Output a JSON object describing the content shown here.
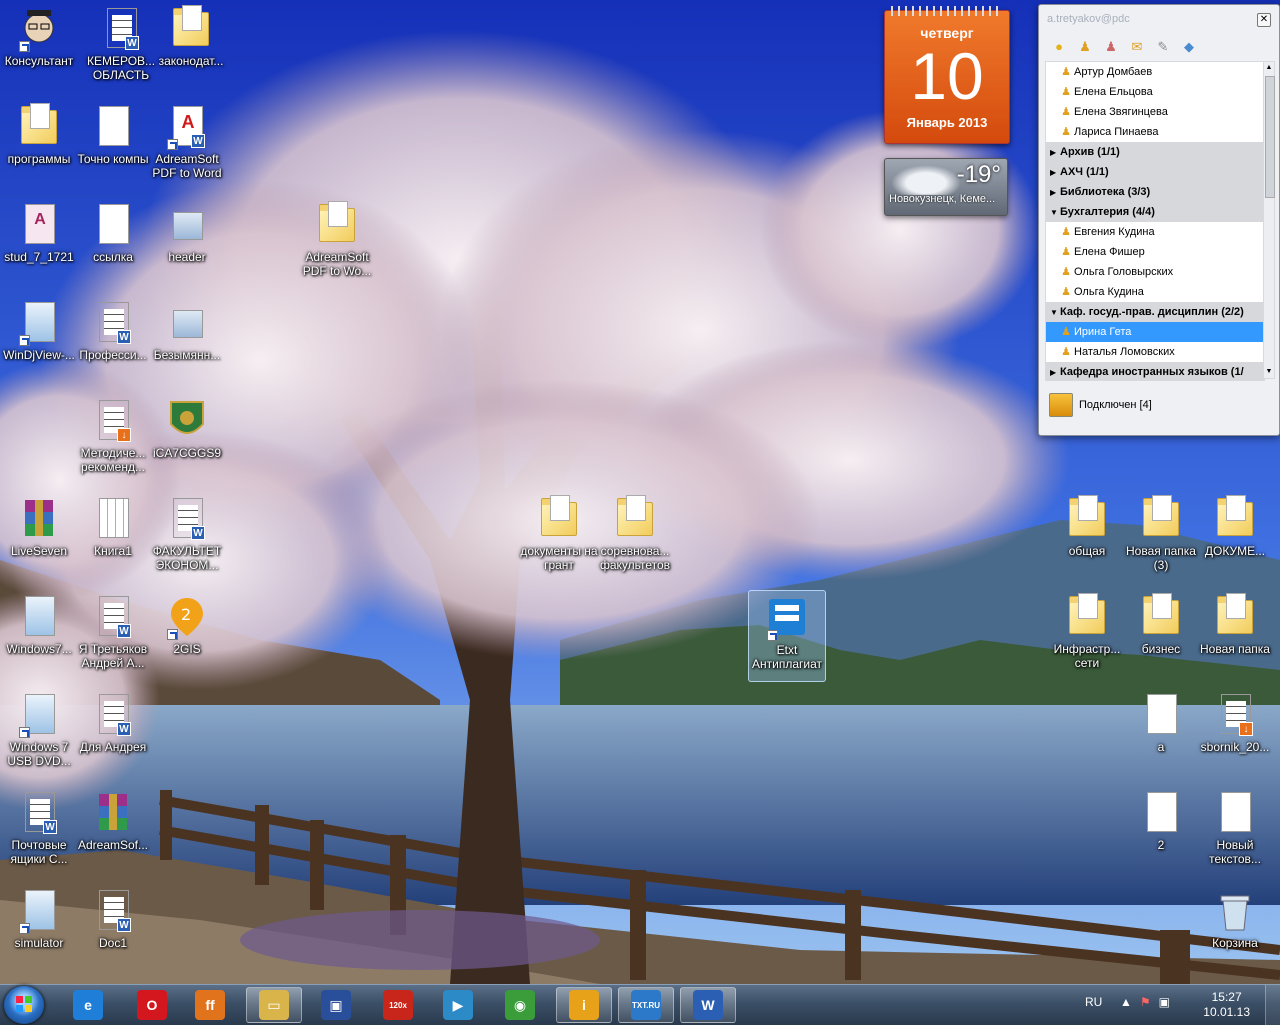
{
  "desktop_icons": [
    {
      "label": "Консультант",
      "icon": "consultant-icon",
      "type": "shortcut"
    },
    {
      "label": "КЕМЕРОВ... ОБЛАСТЬ",
      "icon": "word-doc-icon",
      "type": "doc"
    },
    {
      "label": "законодат...",
      "icon": "folder-icon",
      "type": "folder"
    },
    {
      "label": "программы",
      "icon": "folder-icon",
      "type": "folder"
    },
    {
      "label": "Точно компы",
      "icon": "text-file-icon",
      "type": "doc"
    },
    {
      "label": "AdreamSoft PDF to Word",
      "icon": "pdf-to-word-icon",
      "type": "shortcut"
    },
    {
      "label": "stud_7_1721",
      "icon": "access-db-icon",
      "type": "doc"
    },
    {
      "label": "ссылка",
      "icon": "text-file-icon",
      "type": "doc"
    },
    {
      "label": "header",
      "icon": "image-file-icon",
      "type": "doc"
    },
    {
      "label": "AdreamSoft PDF to Wo...",
      "icon": "folder-icon",
      "type": "folder"
    },
    {
      "label": "WinDjView-...",
      "icon": "installer-icon",
      "type": "shortcut"
    },
    {
      "label": "Професси...",
      "icon": "word-doc-icon",
      "type": "doc"
    },
    {
      "label": "Безымянн...",
      "icon": "image-file-icon",
      "type": "doc"
    },
    {
      "label": "Методиче... рекоменд...",
      "icon": "djvu-doc-icon",
      "type": "doc"
    },
    {
      "label": "iCA7CGGS9",
      "icon": "coat-of-arms-icon",
      "type": "doc"
    },
    {
      "label": "LiveSeven",
      "icon": "winrar-icon",
      "type": "doc"
    },
    {
      "label": "Книга1",
      "icon": "excel-doc-icon",
      "type": "doc"
    },
    {
      "label": "ФАКУЛЬТЕТ ЭКОНОМ...",
      "icon": "word-doc-icon",
      "type": "doc"
    },
    {
      "label": "Windows7...",
      "icon": "installer-icon",
      "type": "doc"
    },
    {
      "label": "Я Третьяков Андрей А...",
      "icon": "word-doc-icon",
      "type": "doc"
    },
    {
      "label": "2GIS",
      "icon": "2gis-icon",
      "type": "shortcut"
    },
    {
      "label": "Windows 7 USB DVD...",
      "icon": "windows-usb-icon",
      "type": "shortcut"
    },
    {
      "label": "Для Андрея",
      "icon": "word-doc-icon",
      "type": "doc"
    },
    {
      "label": "Почтовые ящики С...",
      "icon": "word-doc-icon",
      "type": "doc"
    },
    {
      "label": "AdreamSof...",
      "icon": "winrar-icon",
      "type": "doc"
    },
    {
      "label": "simulator",
      "icon": "simulator-icon",
      "type": "shortcut"
    },
    {
      "label": "Doc1",
      "icon": "word-doc-icon",
      "type": "doc"
    },
    {
      "label": "документы на грант",
      "icon": "folder-icon",
      "type": "folder"
    },
    {
      "label": "соревнова... факультетов",
      "icon": "folder-icon",
      "type": "folder"
    },
    {
      "label": "Etxt Антиплагиат",
      "icon": "etxt-icon",
      "type": "shortcut"
    },
    {
      "label": "общая",
      "icon": "folder-icon",
      "type": "folder"
    },
    {
      "label": "Новая папка (3)",
      "icon": "folder-icon",
      "type": "folder"
    },
    {
      "label": "ДОКУМЕ...",
      "icon": "folder-icon",
      "type": "folder"
    },
    {
      "label": "Инфрастр... сети",
      "icon": "folder-icon",
      "type": "folder"
    },
    {
      "label": "бизнес",
      "icon": "folder-icon",
      "type": "folder"
    },
    {
      "label": "Новая папка",
      "icon": "folder-icon",
      "type": "folder"
    },
    {
      "label": "a",
      "icon": "text-file-icon",
      "type": "doc"
    },
    {
      "label": "sbornik_20...",
      "icon": "djvu-doc-icon",
      "type": "doc"
    },
    {
      "label": "2",
      "icon": "text-file-icon",
      "type": "doc"
    },
    {
      "label": "Новый текстов...",
      "icon": "text-file-icon",
      "type": "doc"
    },
    {
      "label": "Корзина",
      "icon": "recycle-bin-icon",
      "type": "doc"
    }
  ],
  "calendar": {
    "weekday": "четверг",
    "day": "10",
    "month_year": "Январь 2013"
  },
  "weather": {
    "temp": "-19°",
    "city": "Новокузнецк, Кеме..."
  },
  "im": {
    "account": "a.tretyakov@pdc",
    "toolbar_icons": [
      "lamp-icon",
      "user-icon",
      "users-icon",
      "mail-icon",
      "pin-icon",
      "tag-icon"
    ],
    "rows": [
      {
        "kind": "contact",
        "label": "Артур Домбаев"
      },
      {
        "kind": "contact",
        "label": "Елена Ельцова"
      },
      {
        "kind": "contact",
        "label": "Елена Звягинцева"
      },
      {
        "kind": "contact",
        "label": "Лариса Пинаева"
      },
      {
        "kind": "group",
        "label": "Архив (1/1)",
        "expanded": false
      },
      {
        "kind": "group",
        "label": "АХЧ (1/1)",
        "expanded": false
      },
      {
        "kind": "group",
        "label": "Библиотека (3/3)",
        "expanded": false
      },
      {
        "kind": "group",
        "label": "Бухгалтерия (4/4)",
        "expanded": true
      },
      {
        "kind": "contact",
        "label": "Евгения Кудина"
      },
      {
        "kind": "contact",
        "label": "Елена Фишер"
      },
      {
        "kind": "contact",
        "label": "Ольга Головырских"
      },
      {
        "kind": "contact",
        "label": "Ольга Кудина"
      },
      {
        "kind": "group",
        "label": "Каф. госуд.-прав. дисциплин (2/2)",
        "expanded": true
      },
      {
        "kind": "contact",
        "label": "Ирина Гета",
        "selected": true
      },
      {
        "kind": "contact",
        "label": "Наталья Ломовских"
      },
      {
        "kind": "group",
        "label": "Кафедра иностранных языков (1/",
        "expanded": false
      }
    ],
    "status": "Подключен [4]"
  },
  "taskbar": {
    "apps": [
      {
        "name": "ie",
        "icon": "internet-explorer-icon",
        "glyph": "e",
        "color": "#1f7fd8"
      },
      {
        "name": "opera",
        "icon": "opera-icon",
        "glyph": "O",
        "color": "#d4161e"
      },
      {
        "name": "firefox",
        "icon": "firefox-icon",
        "glyph": "ff",
        "color": "#e2731d"
      },
      {
        "name": "explorer",
        "icon": "folder-icon",
        "glyph": "▭",
        "color": "#d9b44a"
      },
      {
        "name": "save",
        "icon": "floppy-icon",
        "glyph": "▣",
        "color": "#2a4f9a"
      },
      {
        "name": "120x",
        "icon": "abbyy-icon",
        "glyph": "120x",
        "color": "#c8261a"
      },
      {
        "name": "media",
        "icon": "media-player-icon",
        "glyph": "▶",
        "color": "#2c8ac7"
      },
      {
        "name": "chrome",
        "icon": "chrome-icon",
        "glyph": "◉",
        "color": "#3a9d3a"
      },
      {
        "name": "im",
        "icon": "im-client-icon",
        "glyph": "i",
        "color": "#e7a21a"
      },
      {
        "name": "etxt",
        "icon": "etxt-icon",
        "glyph": "TXT.RU",
        "color": "#2c79c9"
      },
      {
        "name": "word",
        "icon": "word-icon",
        "glyph": "W",
        "color": "#2b5fb4"
      }
    ],
    "language": "RU",
    "time": "15:27",
    "date": "10.01.13"
  }
}
